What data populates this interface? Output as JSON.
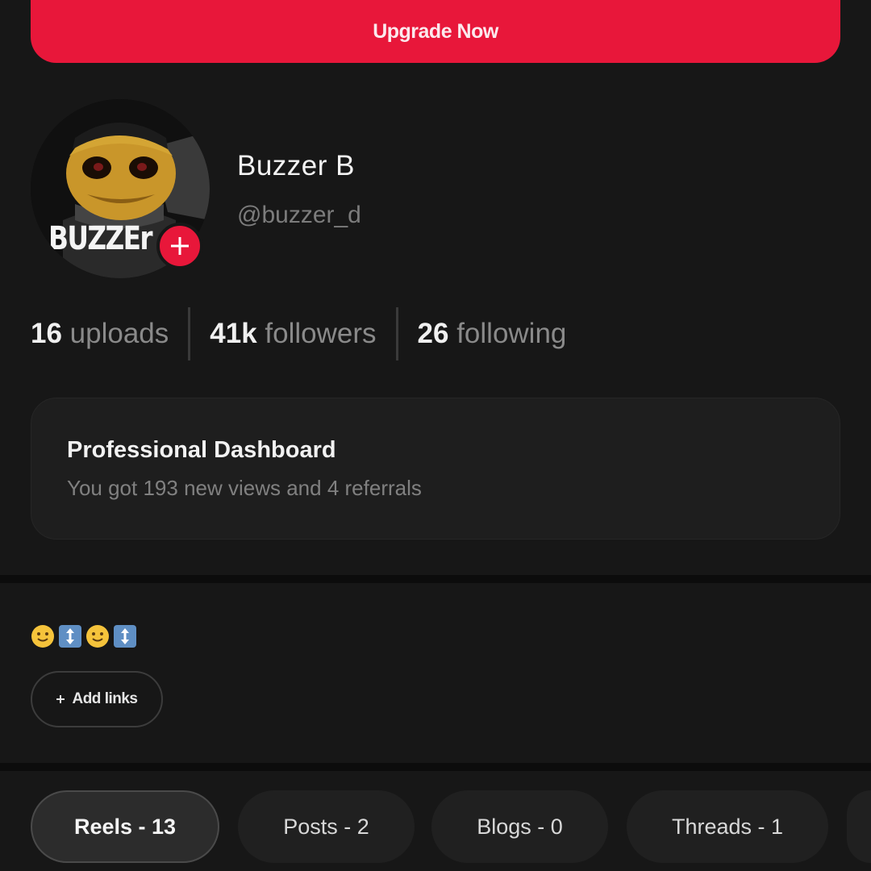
{
  "header": {
    "upgrade_label": "Upgrade Now"
  },
  "profile": {
    "display_name": "Buzzer B",
    "handle": "@buzzer_d",
    "avatar_text": "BUZZEr"
  },
  "stats": [
    {
      "value": "16",
      "label": "uploads"
    },
    {
      "value": "41k",
      "label": "followers"
    },
    {
      "value": "26",
      "label": "following"
    }
  ],
  "dashboard": {
    "title": "Professional Dashboard",
    "subtitle": "You got 193 new views and 4 referrals"
  },
  "bio": {
    "items": [
      "slightly-smiling-face-emoji",
      "up-down-arrow-emoji",
      "slightly-smiling-face-emoji",
      "up-down-arrow-emoji"
    ]
  },
  "links": {
    "add_label": "Add links"
  },
  "tabs": [
    {
      "label": "Reels - 13",
      "active": true
    },
    {
      "label": "Posts - 2",
      "active": false
    },
    {
      "label": "Blogs - 0",
      "active": false
    },
    {
      "label": "Threads - 1",
      "active": false
    }
  ],
  "colors": {
    "accent": "#e8173a",
    "background": "#171717",
    "card": "#1e1e1e"
  }
}
